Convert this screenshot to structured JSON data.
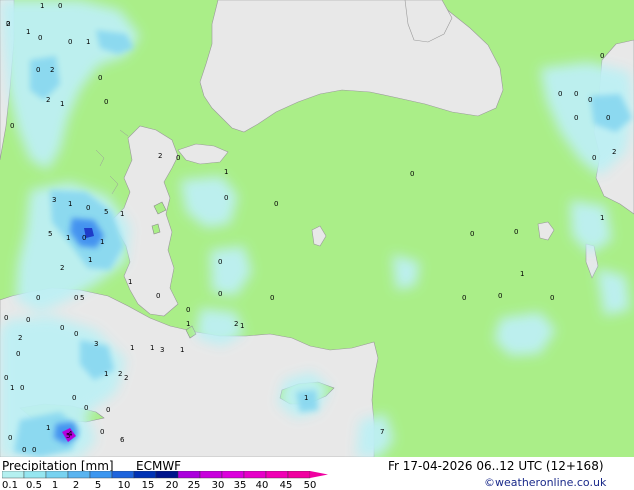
{
  "legend": {
    "title": "Precipitation [mm]",
    "model": "ECMWF",
    "ticks": [
      "0.1",
      "0.5",
      "1",
      "2",
      "5",
      "10",
      "15",
      "20",
      "25",
      "30",
      "35",
      "40",
      "45",
      "50"
    ],
    "colors": [
      "#b4f0f0",
      "#96e6f0",
      "#78d2f0",
      "#5ab4f0",
      "#3c96f0",
      "#1e64dc",
      "#0032b4",
      "#00148c",
      "#aa00dc",
      "#c800dc",
      "#dc00dc",
      "#e600c8",
      "#f000b4",
      "#f000a0"
    ]
  },
  "valid_time": "Fr 17-04-2026 06..12 UTC (12+168)",
  "credit": "©weatheronline.co.uk",
  "colors": {
    "land": "#aaee88",
    "sea": "#e8e8e8",
    "light_precip": "#bdf0f4",
    "moderate_precip": "#8ad8f0",
    "heavy_precip": "#3c8cf0",
    "max_precip": "#b400dc"
  },
  "grid_values": [
    "2",
    "1",
    "0",
    "1",
    "0",
    "0",
    "2",
    "1",
    "0",
    "2",
    "0",
    "1",
    "2",
    "0",
    "1",
    "0",
    "0",
    "0",
    "0",
    "0",
    "0",
    "0",
    "0",
    "0",
    "0",
    "0",
    "0",
    "0",
    "0",
    "0",
    "0",
    "0",
    "0",
    "3",
    "1",
    "0",
    "5",
    "1",
    "5",
    "1",
    "0",
    "1",
    "2",
    "1",
    "5",
    "0",
    "3",
    "1",
    "2",
    "0",
    "0",
    "0",
    "0",
    "1",
    "4",
    "5",
    "6",
    "7",
    "1",
    "1",
    "1",
    "3",
    "1",
    "0",
    "0",
    "0",
    "0",
    "0",
    "1",
    "1",
    "0",
    "2",
    "0",
    "2",
    "1",
    "1",
    "1",
    "0",
    "1",
    "2",
    "0",
    "0",
    "1",
    "0",
    "0",
    "2",
    "0",
    "0",
    "0",
    "0"
  ]
}
